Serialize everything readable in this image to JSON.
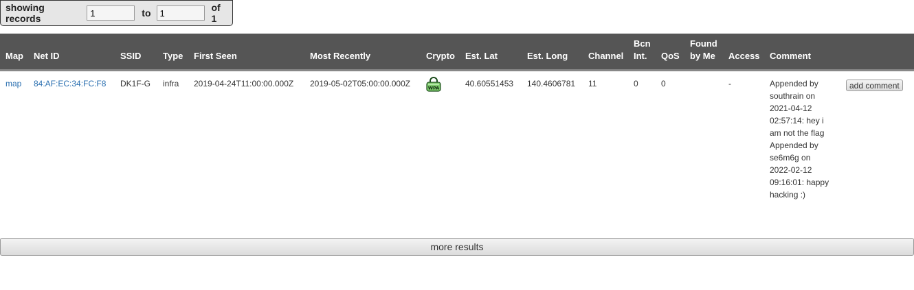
{
  "pager": {
    "showing_label": "showing records",
    "from_value": "1",
    "to_label": "to",
    "to_value": "1",
    "of_label": "of 1"
  },
  "table": {
    "headers": [
      "Map",
      "Net ID",
      "SSID",
      "Type",
      "First Seen",
      "Most Recently",
      "Crypto",
      "Est. Lat",
      "Est. Long",
      "Channel",
      "Bcn Int.",
      "QoS",
      "Found by Me",
      "Access",
      "Comment",
      ""
    ],
    "row": {
      "map": "map",
      "netid": "84:AF:EC:34:FC:F8",
      "ssid": "DK1F-G",
      "type": "infra",
      "first_seen": "2019-04-24T11:00:00.000Z",
      "most_recently": "2019-05-02T05:00:00.000Z",
      "crypto_icon": "wpa-lock-icon",
      "crypto_text": "WPA",
      "lat": "40.60551453",
      "long": "140.4606781",
      "channel": "11",
      "bcn_int": "0",
      "qos": "0",
      "found_by_me": "",
      "access": "-",
      "comment": "Appended by southrain on 2021-04-12 02:57:14: hey i am not the flag Appended by se6m6g on 2022-02-12 09:16:01: happy hacking :)",
      "add_comment": "add comment"
    }
  },
  "more_results": "more results"
}
